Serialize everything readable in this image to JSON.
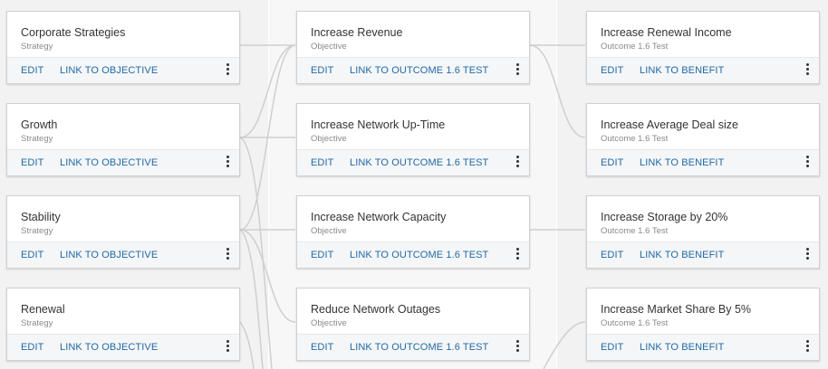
{
  "columns": [
    {
      "key": "strategies",
      "cards": [
        {
          "title": "Corporate Strategies",
          "subtitle": "Strategy",
          "edit": "EDIT",
          "link": "LINK TO OBJECTIVE"
        },
        {
          "title": "Growth",
          "subtitle": "Strategy",
          "edit": "EDIT",
          "link": "LINK TO OBJECTIVE"
        },
        {
          "title": "Stability",
          "subtitle": "Strategy",
          "edit": "EDIT",
          "link": "LINK TO OBJECTIVE"
        },
        {
          "title": "Renewal",
          "subtitle": "Strategy",
          "edit": "EDIT",
          "link": "LINK TO OBJECTIVE"
        }
      ]
    },
    {
      "key": "objectives",
      "cards": [
        {
          "title": "Increase Revenue",
          "subtitle": "Objective",
          "edit": "EDIT",
          "link": "LINK TO OUTCOME 1.6 TEST"
        },
        {
          "title": "Increase Network Up-Time",
          "subtitle": "Objective",
          "edit": "EDIT",
          "link": "LINK TO OUTCOME 1.6 TEST"
        },
        {
          "title": "Increase Network Capacity",
          "subtitle": "Objective",
          "edit": "EDIT",
          "link": "LINK TO OUTCOME 1.6 TEST"
        },
        {
          "title": "Reduce Network Outages",
          "subtitle": "Objective",
          "edit": "EDIT",
          "link": "LINK TO OUTCOME 1.6 TEST"
        }
      ]
    },
    {
      "key": "outcomes",
      "cards": [
        {
          "title": "Increase Renewal Income",
          "subtitle": "Outcome 1.6 Test",
          "edit": "EDIT",
          "link": "LINK TO BENEFIT"
        },
        {
          "title": "Increase Average Deal size",
          "subtitle": "Outcome 1.6 Test",
          "edit": "EDIT",
          "link": "LINK TO BENEFIT"
        },
        {
          "title": "Increase Storage by 20%",
          "subtitle": "Outcome 1.6 Test",
          "edit": "EDIT",
          "link": "LINK TO BENEFIT"
        },
        {
          "title": "Increase Market Share By 5%",
          "subtitle": "Outcome 1.6 Test",
          "edit": "EDIT",
          "link": "LINK TO BENEFIT"
        }
      ]
    }
  ],
  "colors": {
    "link": "#1f6aa5",
    "connector": "#cfcfcf"
  },
  "icons": {
    "menu": "kebab-menu-icon"
  }
}
